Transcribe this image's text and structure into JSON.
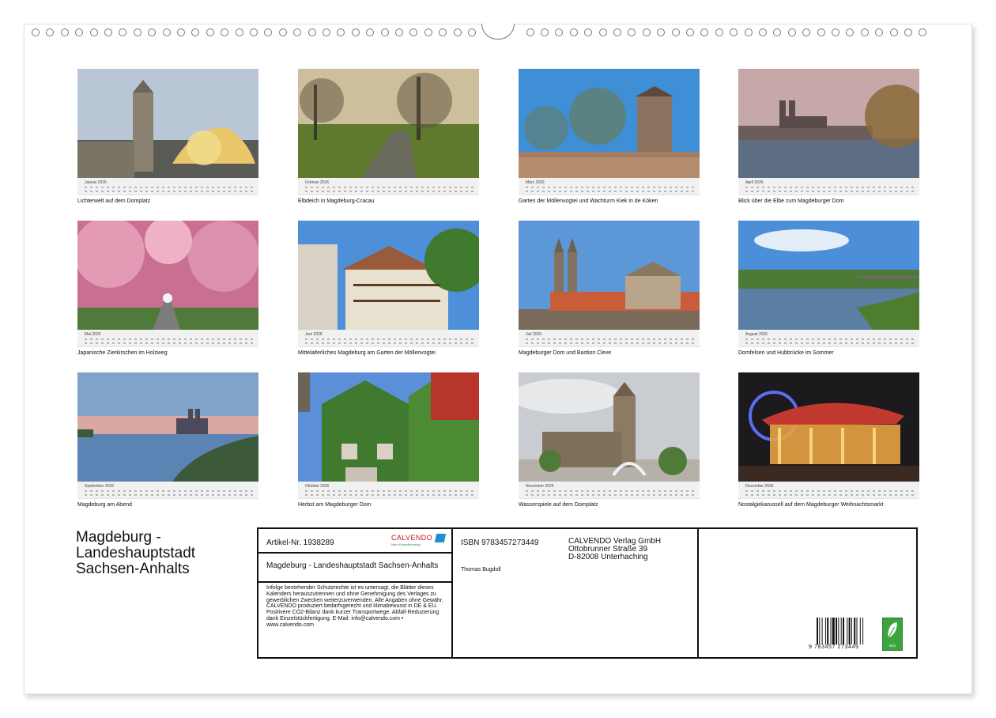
{
  "calendar": {
    "months": [
      {
        "month": "Januar 2026",
        "caption": "Lichterwelt auf dem Domplatz"
      },
      {
        "month": "Februar 2026",
        "caption": "Elbdeich in Magdeburg-Cracau"
      },
      {
        "month": "März 2026",
        "caption": "Garten der Möllenvogtei und Wachturm Kiek in de Köken"
      },
      {
        "month": "April 2026",
        "caption": "Blick über die Elbe zum Magdeburger Dom"
      },
      {
        "month": "Mai 2026",
        "caption": "Japanische Zierkirschen im Holzweg"
      },
      {
        "month": "Juni 2026",
        "caption": "Mittelalterliches Magdeburg am Garten der Möllenvogtei"
      },
      {
        "month": "Juli 2026",
        "caption": "Magdeburger Dom und Bastion Cleve"
      },
      {
        "month": "August 2026",
        "caption": "Domfelsen und Hubbrücke im Sommer"
      },
      {
        "month": "September 2026",
        "caption": "Magdeburg am Abend"
      },
      {
        "month": "Oktober 2026",
        "caption": "Herbst am Magdeburger Dom"
      },
      {
        "month": "November 2026",
        "caption": "Wasserspiele auf dem Domplatz"
      },
      {
        "month": "Dezember 2026",
        "caption": "Nostalgiekarussell auf dem Magdeburger Weihnachtsmarkt"
      }
    ]
  },
  "product": {
    "title": "Magdeburg - Landeshauptstadt Sachsen-Anhalts",
    "article_number": "Artikel-Nr. 1938289",
    "logo_text": "CALVENDO",
    "logo_sub": "Mein Kalenderverlag",
    "calendar_name": "Magdeburg - Landeshauptstadt Sachsen-Anhalts",
    "legal": "Infolge bestehender Schutzrechte ist es untersagt, die Blätter dieses Kalenders herauszutrennen und ohne Genehmigung des Verlages zu gewerblichen Zwecken weiterzuverwenden. Alle Angaben ohne Gewähr. CALVENDO produziert bedarfsgerecht und klimabewusst in DE & EU. Positivere CO2-Bilanz dank kurzer Transportwege. Abfall-Reduzierung dank Einzelstückfertigung. E-Mail: info@calvendo.com • www.calvendo.com",
    "isbn": "ISBN 9783457273449",
    "author": "Thomas Bugdoll",
    "publisher_name": "CALVENDO Verlag GmbH",
    "publisher_street": "Ottobrunner Straße 39",
    "publisher_city": "D-82008 Unterhaching",
    "barcode_number": "9 783457 273449",
    "eco_label": "eco"
  }
}
